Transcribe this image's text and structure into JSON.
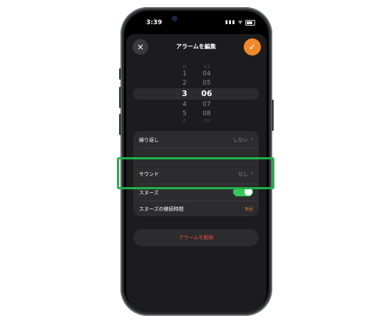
{
  "status_bar": {
    "time": "3:39",
    "signal_wifi": "▮▮▮ ᯤ"
  },
  "header": {
    "title": "アラームを編集",
    "close_icon": "×",
    "confirm_icon": "✓"
  },
  "picker": {
    "hours": [
      "0",
      "1",
      "2",
      "3",
      "4",
      "5",
      "6"
    ],
    "minutes": [
      "03",
      "04",
      "05",
      "06",
      "07",
      "08",
      "09"
    ],
    "selected_hour": "3",
    "selected_minute": "06"
  },
  "settings": {
    "repeat_label": "繰り返し",
    "repeat_value": "しない",
    "sound_label": "サウンド",
    "sound_value": "なし",
    "snooze_label": "スヌーズ",
    "snooze_duration_label": "スヌーズの継続時間",
    "snooze_duration_value": "9分",
    "chevron": "›"
  },
  "delete_label": "アラームを削除",
  "colors": {
    "accent": "#f0882a",
    "highlight": "#1fb24a",
    "toggle_on": "#34c759",
    "danger": "#ff453a"
  }
}
